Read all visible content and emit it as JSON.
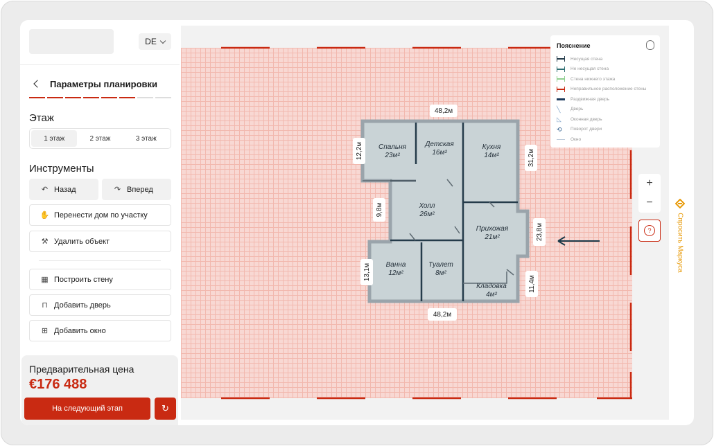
{
  "lang": "DE",
  "header": {
    "title": "Параметры планировки"
  },
  "floor": {
    "heading": "Этаж",
    "tabs": [
      "1 этаж",
      "2 этаж",
      "3 этаж"
    ],
    "active": 0
  },
  "tools": {
    "heading": "Инструменты",
    "undo": "Назад",
    "redo": "Вперед",
    "move": "Перенести дом по участку",
    "delete": "Удалить объект",
    "wall": "Построить стену",
    "door": "Добавить дверь",
    "window": "Добавить окно"
  },
  "price": {
    "label": "Предварительная цена",
    "value": "€176 488"
  },
  "next_button": "На  следующий этап",
  "legend": {
    "title": "Пояснение",
    "items": [
      {
        "label": "Несущая стена",
        "color": "#243b4a"
      },
      {
        "label": "Не несущая стена",
        "color": "#2f6f73"
      },
      {
        "label": "Стена нижнего этажа",
        "color": "#8fcf8f"
      },
      {
        "label": "Неправильное расположение стены",
        "color": "#c92a12"
      },
      {
        "label": "Раздвижная дверь",
        "color": "#1b3a5c"
      },
      {
        "label": "Дверь",
        "color": "#7fa3c8"
      },
      {
        "label": "Оконная дверь",
        "color": "#7fa3c8"
      },
      {
        "label": "Поворот двери",
        "color": "#2a5a8a"
      },
      {
        "label": "Окно",
        "color": "#b9c8d8"
      }
    ]
  },
  "plan": {
    "rooms": [
      {
        "name": "Спальня",
        "area": "23м²"
      },
      {
        "name": "Детская",
        "area": "16м²"
      },
      {
        "name": "Кухня",
        "area": "14м²"
      },
      {
        "name": "Холл",
        "area": "26м²"
      },
      {
        "name": "Прихожая",
        "area": "21м²"
      },
      {
        "name": "Ванна",
        "area": "12м²"
      },
      {
        "name": "Туалет",
        "area": "8м²"
      },
      {
        "name": "Кладовка",
        "area": "4м²"
      }
    ],
    "dims": {
      "top": "48,2м",
      "bottom": "48,2м",
      "left_top": "12,2м",
      "right_top": "31,2м",
      "left_mid": "9,8м",
      "right_mid": "23,8м",
      "left_bottom": "13,1м",
      "right_bottom": "11,4м"
    }
  },
  "ask_label": "Спросить Маркуса",
  "colors": {
    "accent": "#c92a12",
    "plot": "#f8d8d3",
    "wall": "#9aa4ab",
    "ask": "#e89b0a"
  }
}
